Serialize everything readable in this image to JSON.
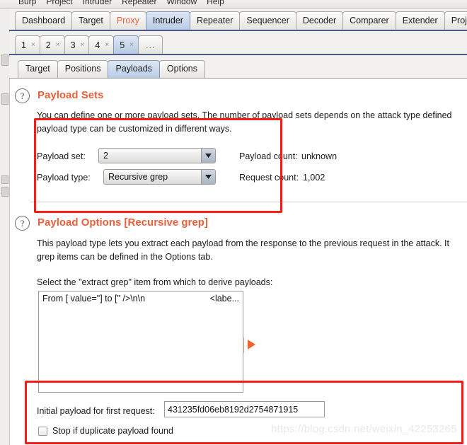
{
  "menu": {
    "items": [
      "Burp",
      "Project",
      "Intruder",
      "Repeater",
      "Window",
      "Help"
    ]
  },
  "main_tabs": [
    {
      "label": "Dashboard",
      "state": "normal"
    },
    {
      "label": "Target",
      "state": "normal"
    },
    {
      "label": "Proxy",
      "state": "warn"
    },
    {
      "label": "Intruder",
      "state": "selected"
    },
    {
      "label": "Repeater",
      "state": "normal"
    },
    {
      "label": "Sequencer",
      "state": "normal"
    },
    {
      "label": "Decoder",
      "state": "normal"
    },
    {
      "label": "Comparer",
      "state": "normal"
    },
    {
      "label": "Extender",
      "state": "normal"
    },
    {
      "label": "Project",
      "state": "normal"
    }
  ],
  "attack_tabs": [
    {
      "label": "1",
      "close": "×",
      "selected": false
    },
    {
      "label": "2",
      "close": "×",
      "selected": false
    },
    {
      "label": "3",
      "close": "×",
      "selected": false
    },
    {
      "label": "4",
      "close": "×",
      "selected": false
    },
    {
      "label": "5",
      "close": "×",
      "selected": true
    },
    {
      "label": "...",
      "close": "",
      "selected": false
    }
  ],
  "sub_tabs": [
    {
      "label": "Target",
      "selected": false
    },
    {
      "label": "Positions",
      "selected": false
    },
    {
      "label": "Payloads",
      "selected": true
    },
    {
      "label": "Options",
      "selected": false
    }
  ],
  "payload_sets": {
    "help_icon": "question-mark-icon",
    "title": "Payload Sets",
    "desc_line1": "You can define one or more payload sets. The number of payload sets depends on the attack type defined",
    "desc_line2": "payload type can be customized in different ways.",
    "payload_set_label": "Payload set:",
    "payload_set_value": "2",
    "payload_type_label": "Payload type:",
    "payload_type_value": "Recursive grep",
    "payload_count_label": "Payload count:",
    "payload_count_value": "unknown",
    "request_count_label": "Request count:",
    "request_count_value": "1,002"
  },
  "payload_options": {
    "help_icon": "question-mark-icon",
    "title": "Payload Options [Recursive grep]",
    "desc_line1": "This payload type lets you extract each payload from the response to the previous request in the attack. It",
    "desc_line2": "grep items can be defined in the Options tab.",
    "select_label": "Select the \"extract grep\" item from which to derive payloads:",
    "grep_items": [
      {
        "expression": "From [ value=\"] to [\" />\\n\\n",
        "note": "<labe..."
      }
    ],
    "initial_payload_label": "Initial payload for first request:",
    "initial_payload_value": "431235fd06eb8192d2754871915",
    "stop_duplicate_label": "Stop if duplicate payload found",
    "stop_duplicate_checked": false,
    "play_button_icon": "play-triangle-icon"
  },
  "watermark": {
    "text": "https://blog.csdn.net/weixin_42253265"
  },
  "colors": {
    "accent_orange": "#e8603c",
    "annotation_red": "#fb1a15",
    "tab_selected": "#b9cde6",
    "play_triangle": "#f4622d"
  }
}
